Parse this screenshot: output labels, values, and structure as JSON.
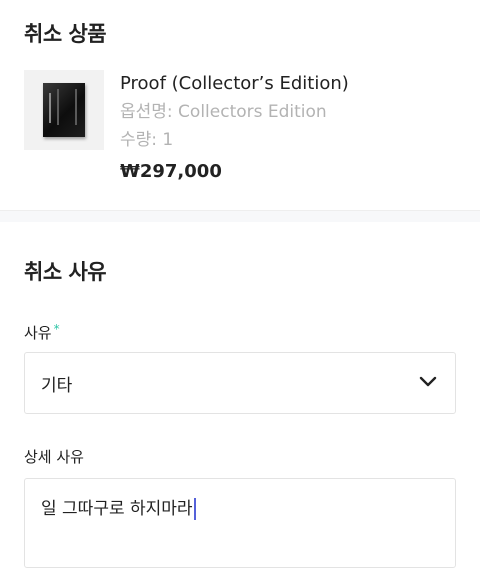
{
  "cancel_items": {
    "title": "취소 상품",
    "product": {
      "name": "Proof (Collector’s Edition)",
      "option": "옵션명: Collectors Edition",
      "quantity": "수량: 1",
      "price": "₩297,000"
    }
  },
  "cancel_reason": {
    "title": "취소 사유",
    "reason_label": "사유",
    "required_mark": "*",
    "reason_selected": "기타",
    "detail_label": "상세 사유",
    "detail_value": "일 그따구로 하지마라"
  },
  "icons": {
    "dropdown": "chevron-down-icon"
  },
  "colors": {
    "required": "#2bc4a5",
    "caret": "#5561d9",
    "muted_text": "#b3b3b3"
  }
}
